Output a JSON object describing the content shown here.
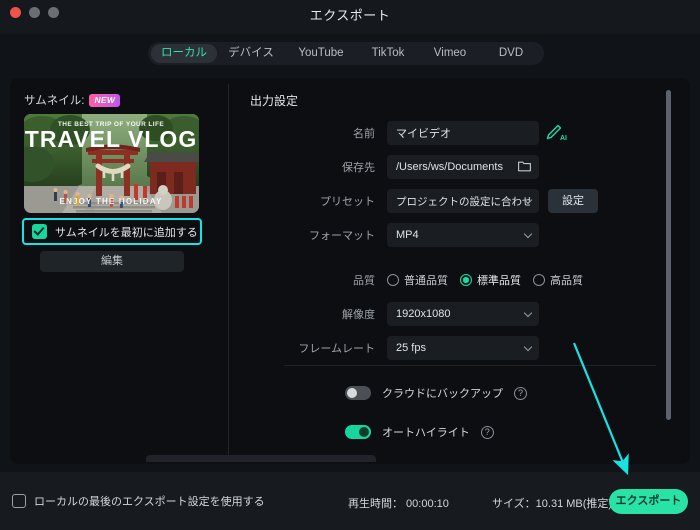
{
  "window": {
    "title": "エクスポート",
    "controls": [
      "close",
      "minimize",
      "maximize"
    ]
  },
  "tabs": [
    {
      "label": "ローカル",
      "active": true
    },
    {
      "label": "デバイス",
      "active": false
    },
    {
      "label": "YouTube",
      "active": false
    },
    {
      "label": "TikTok",
      "active": false
    },
    {
      "label": "Vimeo",
      "active": false
    },
    {
      "label": "DVD",
      "active": false
    }
  ],
  "left_panel": {
    "thumbnail_label": "サムネイル:",
    "badge": "NEW",
    "thumbnail_image": {
      "headline_small": "THE BEST TRIP OF YOUR LIFE",
      "headline_main": "TRAVEL VLOG",
      "caption": "ENJOY THE HOLIDAY"
    },
    "checkbox_label": "サムネイルを最初に追加する",
    "checkbox_checked": true,
    "edit_button": "編集"
  },
  "output_settings": {
    "section_title": "出力設定",
    "name": {
      "label": "名前",
      "value": "マイビデオ",
      "ai_icon": "ai-pen-icon"
    },
    "save_to": {
      "label": "保存先",
      "value": "/Users/ws/Documents",
      "icon": "folder-icon"
    },
    "preset": {
      "label": "プリセット",
      "value": "プロジェクトの設定に合わせる",
      "settings_button": "設定"
    },
    "format": {
      "label": "フォーマット",
      "value": "MP4"
    },
    "quality": {
      "label": "品質",
      "options": [
        {
          "label": "普通品質",
          "selected": false
        },
        {
          "label": "標準品質",
          "selected": true
        },
        {
          "label": "高品質",
          "selected": false
        }
      ]
    },
    "resolution": {
      "label": "解像度",
      "value": "1920x1080"
    },
    "framerate": {
      "label": "フレームレート",
      "value": "25 fps"
    },
    "cloud_backup": {
      "label": "クラウドにバックアップ",
      "enabled": false,
      "help": "?"
    },
    "auto_highlight": {
      "label": "オートハイライト",
      "enabled": true,
      "help": "?"
    }
  },
  "bottom_bar": {
    "use_last_settings": {
      "label": "ローカルの最後のエクスポート設定を使用する",
      "checked": false
    },
    "duration": "再生時間：  00:00:10",
    "size": "サイズ：10.31 MB(推定)",
    "export_button": "エクスポート"
  },
  "colors": {
    "accent_green": "#29e2a6",
    "annotation_cyan": "#18e3e3",
    "badge_gradient_start": "#ff5fa2",
    "badge_gradient_end": "#c455f0",
    "window_bg": "#101317"
  }
}
